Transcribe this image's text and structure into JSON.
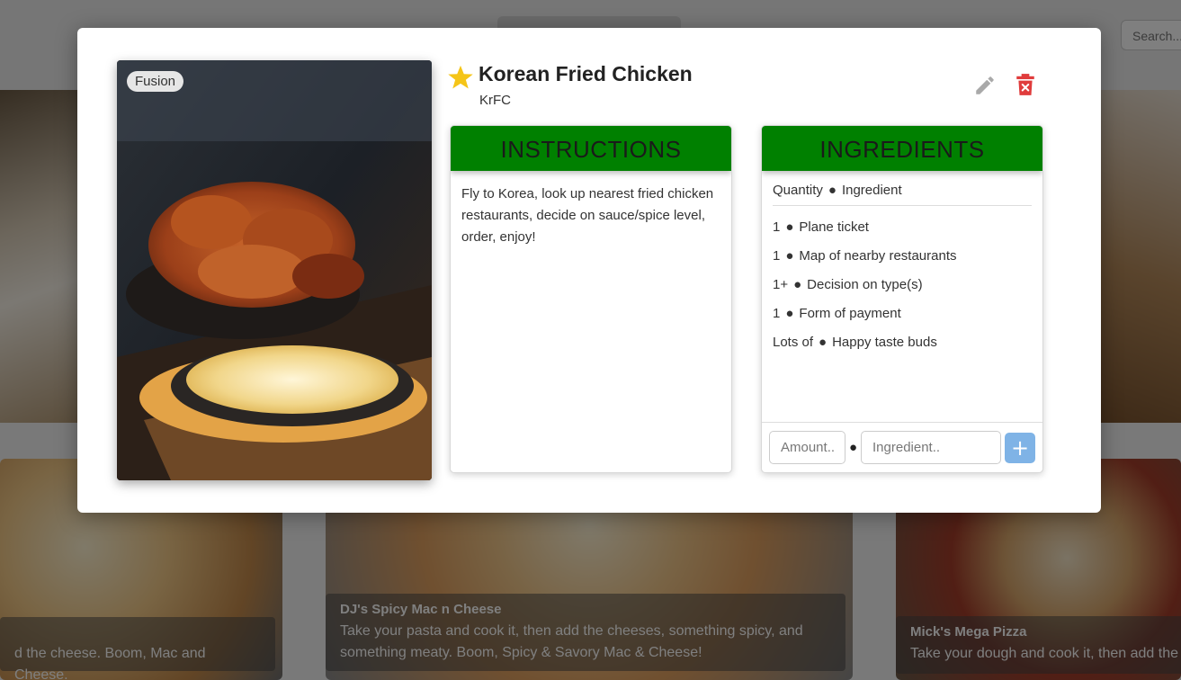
{
  "background": {
    "search_placeholder": "Search...",
    "cards": [
      {
        "title": "",
        "description": "d the cheese. Boom, Mac and Cheese."
      },
      {
        "title": "DJ's Spicy Mac n Cheese",
        "description": "Take your pasta and cook it, then add the cheeses, something spicy, and something meaty. Boom, Spicy & Savory Mac & Cheese!"
      },
      {
        "title": "Mick's Mega Pizza",
        "description": "Take your dough and cook it, then add the"
      }
    ]
  },
  "recipe": {
    "category_tag": "Fusion",
    "title": "Korean Fried Chicken",
    "subtitle": "KrFC",
    "favorite": true,
    "icons": {
      "favorite": "star-icon",
      "edit": "pencil-icon",
      "delete": "trash-icon",
      "add": "plus-icon"
    },
    "colors": {
      "panel_header": "#008000",
      "star": "#f5c518",
      "delete": "#e03c3c",
      "add_button": "#7fb3e6"
    }
  },
  "instructions": {
    "header": "INSTRUCTIONS",
    "text": "Fly to Korea, look up nearest fried chicken restaurants, decide on sauce/spice level, order, enjoy!"
  },
  "ingredients": {
    "header": "INGREDIENTS",
    "column_quantity": "Quantity",
    "column_ingredient": "Ingredient",
    "separator": "●",
    "items": [
      {
        "quantity": "1",
        "name": "Plane ticket"
      },
      {
        "quantity": "1",
        "name": "Map of nearby restaurants"
      },
      {
        "quantity": "1+",
        "name": "Decision on type(s)"
      },
      {
        "quantity": "1",
        "name": "Form of payment"
      },
      {
        "quantity": "Lots of",
        "name": "Happy taste buds"
      }
    ],
    "amount_placeholder": "Amount..",
    "ingredient_placeholder": "Ingredient..",
    "add_label": "+"
  }
}
